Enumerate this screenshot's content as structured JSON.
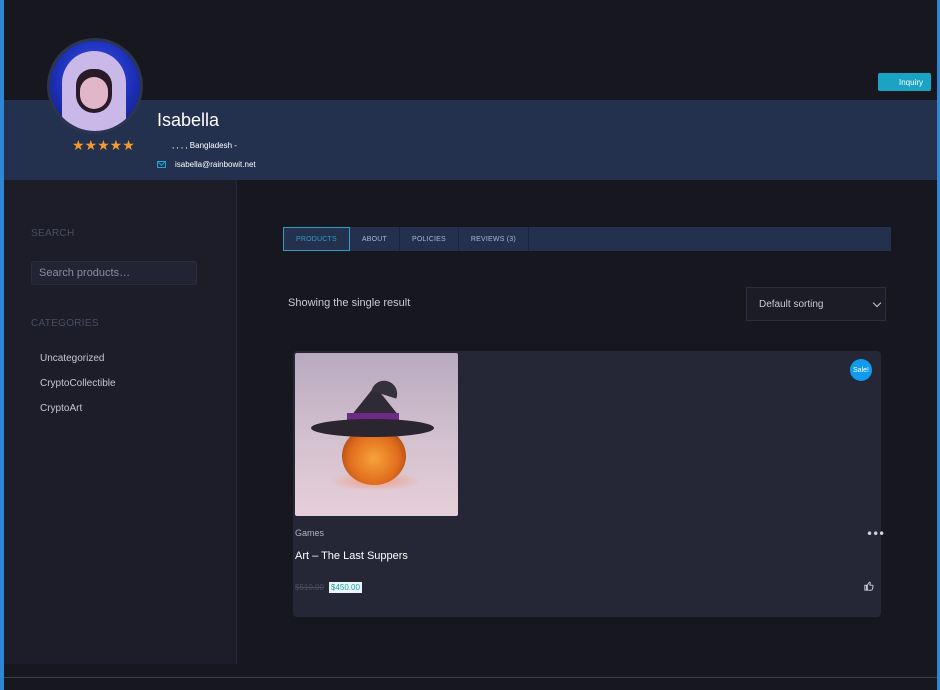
{
  "vendor": {
    "name": "Isabella",
    "address": ", , , , Bangladesh -",
    "email": "isabella@rainbowit.net",
    "rating_stars": "★★★★★",
    "rating": 5
  },
  "header": {
    "inquiry_label": "Inquiry"
  },
  "sidebar": {
    "search_heading": "SEARCH",
    "search_placeholder": "Search products…",
    "categories_heading": "CATEGORIES",
    "categories": [
      "Uncategorized",
      "CryptoCollectible",
      "CryptoArt"
    ]
  },
  "tabs": [
    {
      "label": "PRODUCTS",
      "active": true
    },
    {
      "label": "ABOUT",
      "active": false
    },
    {
      "label": "POLICIES",
      "active": false
    },
    {
      "label": "REVIEWS (3)",
      "active": false
    }
  ],
  "shop": {
    "result_count": "Showing the single result",
    "sort_selected": "Default sorting"
  },
  "product": {
    "sale_badge": "Sale!",
    "category": "Games",
    "title": "Art – The Last Suppers",
    "price_old": "$510.00",
    "price_new": "$450.00",
    "more_icon": "more-horizontal-icon",
    "like_icon": "thumbs-up-icon"
  },
  "colors": {
    "accent": "#1ba3c4",
    "header_band": "#23314f",
    "star": "#f59a2b",
    "sale": "#109bef"
  }
}
